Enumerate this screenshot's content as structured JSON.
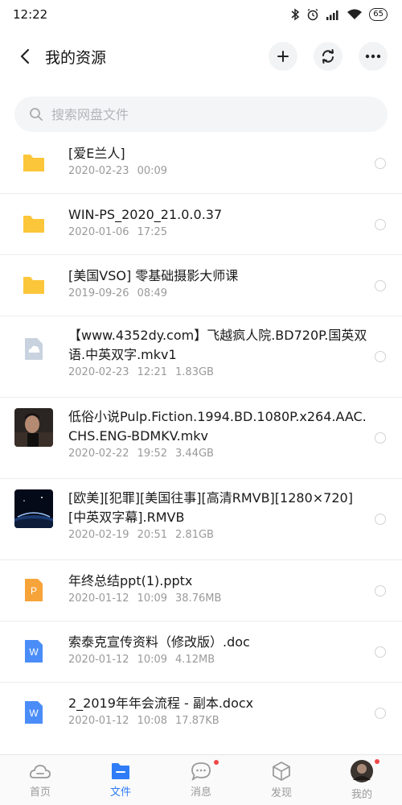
{
  "status_bar": {
    "time": "12:22",
    "battery": "65",
    "icons": [
      "bluetooth-icon",
      "alarm-icon",
      "signal-icon",
      "wifi-icon",
      "battery-icon"
    ]
  },
  "header": {
    "title": "我的资源",
    "actions": [
      "add-icon",
      "refresh-icon",
      "more-icon"
    ]
  },
  "search": {
    "placeholder": "搜索网盘文件"
  },
  "files": [
    {
      "name": "[爱E兰人]",
      "date": "2020-02-23",
      "time": "00:09",
      "size": "",
      "type": "folder"
    },
    {
      "name": "WIN-PS_2020_21.0.0.37",
      "date": "2020-01-06",
      "time": "17:25",
      "size": "",
      "type": "folder"
    },
    {
      "name": "[美国VSO] 零基础摄影大师课",
      "date": "2019-09-26",
      "time": "08:49",
      "size": "",
      "type": "folder"
    },
    {
      "name": "【www.4352dy.com】飞越疯人院.BD720P.国英双语.中英双字.mkv1",
      "date": "2020-02-23",
      "time": "12:21",
      "size": "1.83GB",
      "type": "cloud-file"
    },
    {
      "name": "低俗小说Pulp.Fiction.1994.BD.1080P.x264.AAC.CHS.ENG-BDMKV.mkv",
      "date": "2020-02-22",
      "time": "19:52",
      "size": "3.44GB",
      "type": "video"
    },
    {
      "name": "[欧美][犯罪][美国往事][高清RMVB][1280×720][中英双字幕].RMVB",
      "date": "2020-02-19",
      "time": "20:51",
      "size": "2.81GB",
      "type": "video"
    },
    {
      "name": "年终总结ppt(1).pptx",
      "date": "2020-01-12",
      "time": "10:09",
      "size": "38.76MB",
      "type": "ppt"
    },
    {
      "name": "索泰克宣传资料（修改版）.doc",
      "date": "2020-01-12",
      "time": "10:09",
      "size": "4.12MB",
      "type": "word"
    },
    {
      "name": "2_2019年年会流程 - 副本.docx",
      "date": "2020-01-12",
      "time": "10:08",
      "size": "17.87KB",
      "type": "word"
    }
  ],
  "nav": {
    "home": "首页",
    "files": "文件",
    "messages": "消息",
    "discover": "发现",
    "me": "我的"
  },
  "colors": {
    "accent": "#2f7cf6",
    "folder": "#fcc63a",
    "ppt": "#f6a43a",
    "word": "#4b8df8",
    "badge": "#f04848"
  }
}
